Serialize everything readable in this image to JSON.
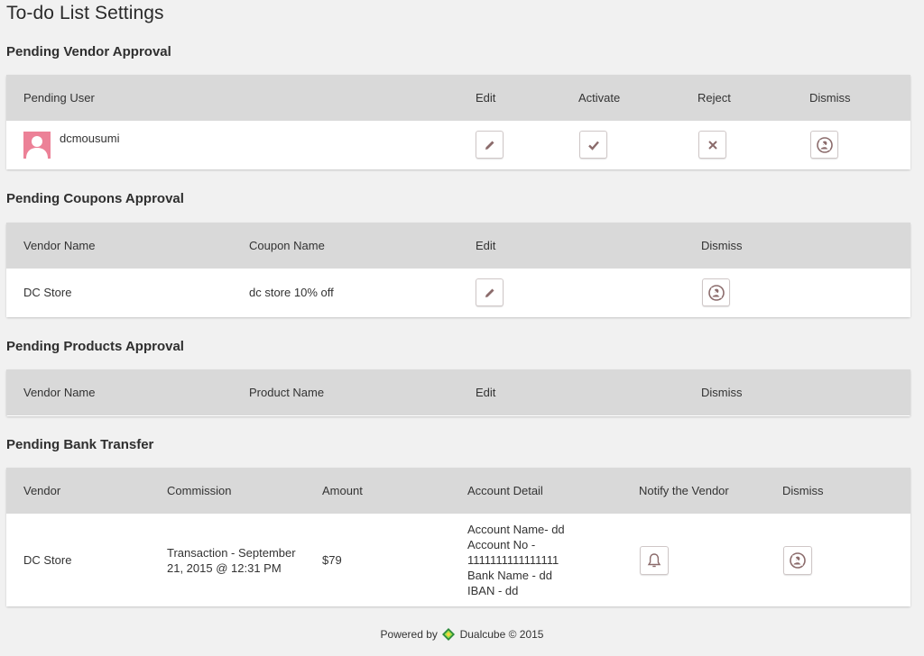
{
  "page": {
    "title": "To-do List Settings"
  },
  "vendor_approval": {
    "title": "Pending Vendor Approval",
    "headers": {
      "user": "Pending User",
      "edit": "Edit",
      "activate": "Activate",
      "reject": "Reject",
      "dismiss": "Dismiss"
    },
    "rows": [
      {
        "user": "dcmousumi"
      }
    ]
  },
  "coupons_approval": {
    "title": "Pending Coupons Approval",
    "headers": {
      "vendor": "Vendor Name",
      "coupon": "Coupon Name",
      "edit": "Edit",
      "dismiss": "Dismiss"
    },
    "rows": [
      {
        "vendor": "DC Store",
        "coupon": "dc store 10% off"
      }
    ]
  },
  "products_approval": {
    "title": "Pending Products Approval",
    "headers": {
      "vendor": "Vendor Name",
      "product": "Product Name",
      "edit": "Edit",
      "dismiss": "Dismiss"
    }
  },
  "bank_transfer": {
    "title": "Pending Bank Transfer",
    "headers": {
      "vendor": "Vendor",
      "commission": "Commission",
      "amount": "Amount",
      "account": "Account Detail",
      "notify": "Notify the Vendor",
      "dismiss": "Dismiss"
    },
    "rows": [
      {
        "vendor": "DC Store",
        "commission_line1": "Transaction - September",
        "commission_line2": "21, 2015 @ 12:31 PM",
        "amount": "$79",
        "account_name": "Account Name- dd",
        "account_no_label": "Account No -",
        "account_no": "1111111111111111",
        "bank_name": "Bank Name - dd",
        "iban": "IBAN - dd"
      }
    ]
  },
  "footer": {
    "powered_by": "Powered by",
    "brand": "Dualcube © 2015"
  },
  "colors": {
    "link": "#e67e52",
    "header_bg": "#d9d9d9",
    "avatar": "#ec8197",
    "icon": "#8b6b6b"
  },
  "icons": [
    "pencil-icon",
    "check-icon",
    "x-icon",
    "dismiss-user-icon",
    "bell-icon",
    "dualcube-logo-icon"
  ]
}
